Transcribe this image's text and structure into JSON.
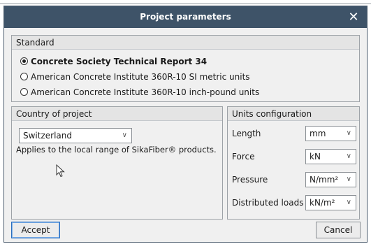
{
  "dialog": {
    "title": "Project parameters",
    "close_glyph": "✕"
  },
  "standard": {
    "heading": "Standard",
    "options": [
      {
        "label": "Concrete Society Technical Report 34",
        "selected": true
      },
      {
        "label": "American Concrete Institute 360R-10 SI metric units",
        "selected": false
      },
      {
        "label": "American Concrete Institute 360R-10 inch-pound units",
        "selected": false
      }
    ]
  },
  "country": {
    "heading": "Country of project",
    "selected": "Switzerland",
    "note": "Applies to the local range of SikaFiber® products."
  },
  "units": {
    "heading": "Units configuration",
    "rows": [
      {
        "label": "Length",
        "value": "mm"
      },
      {
        "label": "Force",
        "value": "kN"
      },
      {
        "label": "Pressure",
        "value": "N/mm²"
      },
      {
        "label": "Distributed loads",
        "value": "kN/m²"
      }
    ]
  },
  "footer": {
    "accept_label": "Accept",
    "cancel_label": "Cancel"
  },
  "icons": {
    "dropdown": "chevron-down-icon",
    "close": "close-icon",
    "pointer": "mouse-pointer-icon"
  },
  "colors": {
    "titlebar": "#3e5368",
    "dialog_bg": "#f0f0f0",
    "accept_border": "#2a6ebf"
  }
}
